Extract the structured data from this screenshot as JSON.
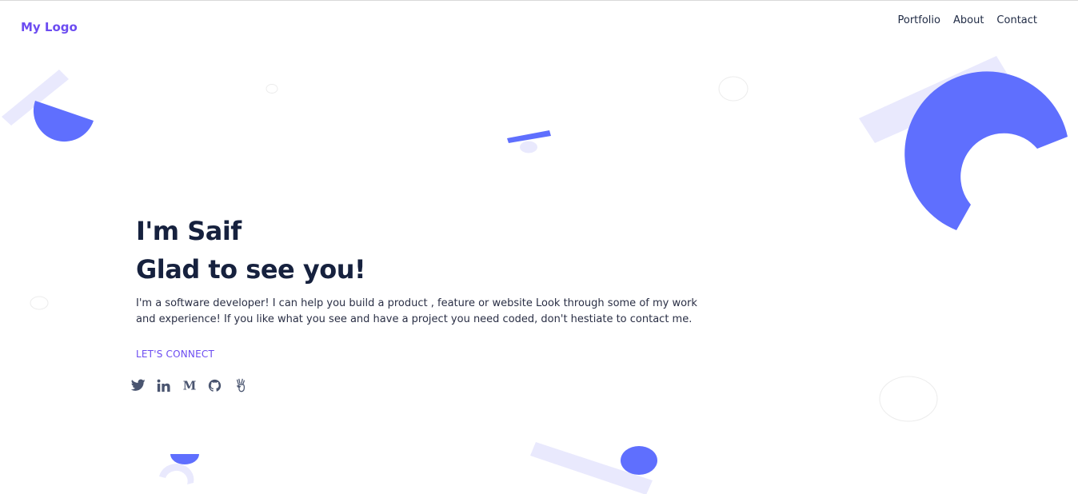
{
  "header": {
    "logo": "My Logo",
    "nav": [
      {
        "label": "Portfolio"
      },
      {
        "label": "About"
      },
      {
        "label": "Contact"
      }
    ]
  },
  "hero": {
    "title_line1": "I'm Saif",
    "title_line2": "Glad to see you!",
    "description": "I'm a software developer! I can help you build a product , feature or website Look through some of my work and experience! If you like what you see and have a project you need coded, don't hestiate to contact me.",
    "cta_label": "LET'S CONNECT"
  },
  "socials": [
    {
      "icon": "twitter-icon"
    },
    {
      "icon": "linkedin-icon"
    },
    {
      "icon": "medium-icon"
    },
    {
      "icon": "github-icon"
    },
    {
      "icon": "angellist-icon"
    }
  ],
  "colors": {
    "accent": "#6c4cf1",
    "shape_blue": "#5f6ffe",
    "shape_light": "#e9e9fd",
    "heading": "#16213e",
    "text": "#2a2f45",
    "icon": "#4a5570"
  }
}
